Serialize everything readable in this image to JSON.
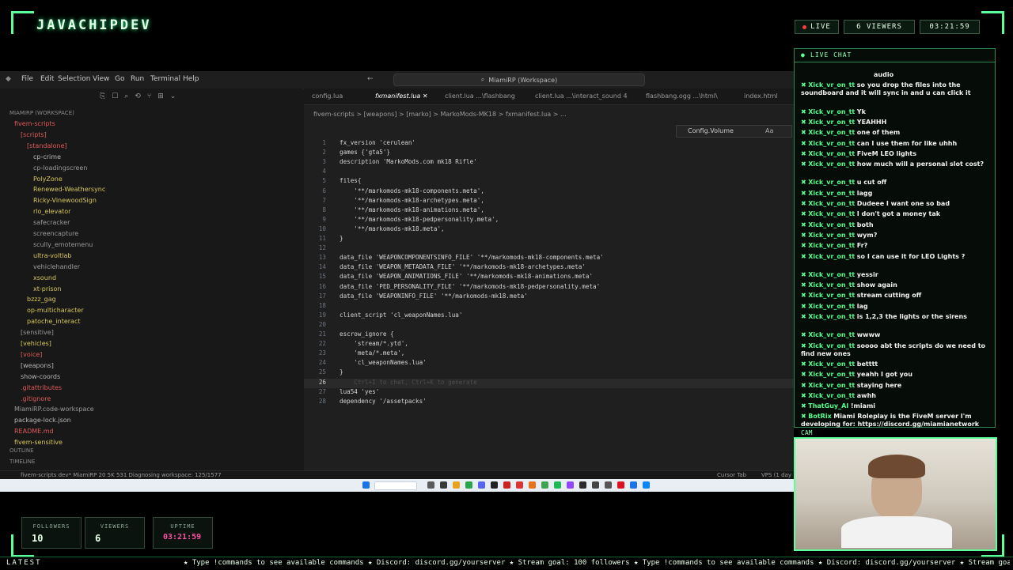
{
  "overlay": {
    "brand": "JAVACHIPDEV",
    "live": "LIVE",
    "viewers": "6  VIEWERS",
    "clock": "03:21:59",
    "chat_title": "LIVE CHAT",
    "cam_label": "CAM",
    "stats": [
      {
        "label": "FOLLOWERS",
        "value": "10"
      },
      {
        "label": "VIEWERS",
        "value": "6"
      },
      {
        "label": "UPTIME",
        "value": "03:21:59"
      }
    ],
    "latest_label": "LATEST",
    "ticker": "★ Type !commands to see available commands ★ Discord: discord.gg/yourserver ★ Stream goal: 100 followers ★ Type !commands to see available commands ★ Discord: discord.gg/yourserver ★ Stream goal: 100 followers"
  },
  "ide": {
    "menu": [
      "File",
      "Edit",
      "Selection",
      "View",
      "Go",
      "Run",
      "Terminal",
      "Help"
    ],
    "search_text": "MiamiRP (Workspace)",
    "workspace_label": "MIAMIRP (WORKSPACE)",
    "tree": [
      {
        "label": "fivem-scripts",
        "indent": 1,
        "color": "#e05a5a"
      },
      {
        "label": "[scripts]",
        "indent": 2,
        "color": "#e05a5a"
      },
      {
        "label": "[standalone]",
        "indent": 3,
        "color": "#e05a5a"
      },
      {
        "label": "cp-crime",
        "indent": 4,
        "color": "#b8b8b8"
      },
      {
        "label": "cp-loadingscreen",
        "indent": 4,
        "color": "#9a9a9a"
      },
      {
        "label": "PolyZone",
        "indent": 4,
        "color": "#d6c65a"
      },
      {
        "label": "Renewed-Weathersync",
        "indent": 4,
        "color": "#d6c65a"
      },
      {
        "label": "Ricky-VinewoodSign",
        "indent": 4,
        "color": "#d6c65a"
      },
      {
        "label": "rlo_elevator",
        "indent": 4,
        "color": "#d6c65a"
      },
      {
        "label": "safecracker",
        "indent": 4,
        "color": "#9a9a9a"
      },
      {
        "label": "screencapture",
        "indent": 4,
        "color": "#9a9a9a"
      },
      {
        "label": "scully_emotemenu",
        "indent": 4,
        "color": "#9a9a9a"
      },
      {
        "label": "ultra-voltlab",
        "indent": 4,
        "color": "#d6c65a"
      },
      {
        "label": "vehiclehandler",
        "indent": 4,
        "color": "#9a9a9a"
      },
      {
        "label": "xsound",
        "indent": 4,
        "color": "#d6c65a"
      },
      {
        "label": "xt-prison",
        "indent": 4,
        "color": "#d6c65a"
      },
      {
        "label": "bzzz_gag",
        "indent": 3,
        "color": "#d6c65a"
      },
      {
        "label": "op-multicharacter",
        "indent": 3,
        "color": "#d6c65a"
      },
      {
        "label": "patoche_interact",
        "indent": 3,
        "color": "#d6c65a"
      },
      {
        "label": "[sensitive]",
        "indent": 2,
        "color": "#9a9a9a"
      },
      {
        "label": "[vehicles]",
        "indent": 2,
        "color": "#d6c65a"
      },
      {
        "label": "[voice]",
        "indent": 2,
        "color": "#e05a5a"
      },
      {
        "label": "[weapons]",
        "indent": 2,
        "color": "#b8b8b8"
      },
      {
        "label": "show-coords",
        "indent": 2,
        "color": "#b8b8b8"
      },
      {
        "label": ".gitattributes",
        "indent": 2,
        "color": "#e05a5a"
      },
      {
        "label": ".gitignore",
        "indent": 2,
        "color": "#e05a5a"
      },
      {
        "label": "MiamiRP.code-workspace",
        "indent": 1,
        "color": "#9a9a9a"
      },
      {
        "label": "package-lock.json",
        "indent": 1,
        "color": "#b8b8b8"
      },
      {
        "label": "README.md",
        "indent": 1,
        "color": "#e05a5a"
      },
      {
        "label": "fivem-sensitive",
        "indent": 1,
        "color": "#d6c65a"
      }
    ],
    "outline_label": "OUTLINE",
    "timeline_label": "TIMELINE",
    "tabs": [
      {
        "label": "config.lua",
        "active": false
      },
      {
        "label": "fxmanifest.lua",
        "active": true
      },
      {
        "label": "client.lua  ...\\flashbang",
        "active": false
      },
      {
        "label": "client.lua  ...\\interact_sound 4",
        "active": false
      },
      {
        "label": "flashbang.ogg  ...\\html\\",
        "active": false
      },
      {
        "label": "index.html",
        "active": false
      }
    ],
    "breadcrumb": "fivem-scripts > [weapons] > [marko] > MarkoMods-MK18 > fxmanifest.lua > ...",
    "find_text": "Config.Volume",
    "code": [
      {
        "n": "1",
        "t": "fx_version 'cerulean'"
      },
      {
        "n": "2",
        "t": "games {'gta5'}"
      },
      {
        "n": "3",
        "t": "description 'MarkoMods.com mk18 Rifle'"
      },
      {
        "n": "4",
        "t": ""
      },
      {
        "n": "5",
        "t": "files{"
      },
      {
        "n": "6",
        "t": "    '**/markomods-mk18-components.meta',"
      },
      {
        "n": "7",
        "t": "    '**/markomods-mk18-archetypes.meta',"
      },
      {
        "n": "8",
        "t": "    '**/markomods-mk18-animations.meta',"
      },
      {
        "n": "9",
        "t": "    '**/markomods-mk18-pedpersonality.meta',"
      },
      {
        "n": "10",
        "t": "    '**/markomods-mk18.meta',"
      },
      {
        "n": "11",
        "t": "}"
      },
      {
        "n": "12",
        "t": ""
      },
      {
        "n": "13",
        "t": "data_file 'WEAPONCOMPONENTSINFO_FILE' '**/markomods-mk18-components.meta'"
      },
      {
        "n": "14",
        "t": "data_file 'WEAPON_METADATA_FILE' '**/markomods-mk18-archetypes.meta'"
      },
      {
        "n": "15",
        "t": "data_file 'WEAPON_ANIMATIONS_FILE' '**/markomods-mk18-animations.meta'"
      },
      {
        "n": "16",
        "t": "data_file 'PED_PERSONALITY_FILE' '**/markomods-mk18-pedpersonality.meta'"
      },
      {
        "n": "17",
        "t": "data_file 'WEAPONINFO_FILE' '**/markomods-mk18.meta'"
      },
      {
        "n": "18",
        "t": ""
      },
      {
        "n": "19",
        "t": "client_script 'cl_weaponNames.lua'"
      },
      {
        "n": "20",
        "t": ""
      },
      {
        "n": "21",
        "t": "escrow_ignore {"
      },
      {
        "n": "22",
        "t": "    'stream/*.ytd',"
      },
      {
        "n": "23",
        "t": "    'meta/*.meta',"
      },
      {
        "n": "24",
        "t": "    'cl_weaponNames.lua'"
      },
      {
        "n": "25",
        "t": "}"
      },
      {
        "n": "26",
        "t": "    Ctrl+I to chat, Ctrl+K to generate"
      },
      {
        "n": "27",
        "t": "lua54 'yes'"
      },
      {
        "n": "28",
        "t": "dependency '/assetpacks'"
      }
    ],
    "status": {
      "left": "fivem-scripts   dev*   MiamiRP   20  5K  531   Diagnosing workspace: 125/1577",
      "cursor": "Cursor Tab",
      "vps": "VPS (1 day"
    }
  },
  "chat": {
    "messages": [
      {
        "user": "",
        "text": "audio"
      },
      {
        "user": "Xick_vr_on_tt",
        "text": "so you drop the files into the soundboard and it will sync in and u can click it"
      },
      {
        "user": "Xick_vr_on_tt",
        "text": "Yk"
      },
      {
        "user": "Xick_vr_on_tt",
        "text": "YEAHHH"
      },
      {
        "user": "Xick_vr_on_tt",
        "text": "one of them"
      },
      {
        "user": "Xick_vr_on_tt",
        "text": "can I use them for like uhhh"
      },
      {
        "user": "Xick_vr_on_tt",
        "text": "FiveM LEO lights"
      },
      {
        "user": "Xick_vr_on_tt",
        "text": "how much will a personal slot cost?"
      },
      {
        "user": "Xick_vr_on_tt",
        "text": "u cut off"
      },
      {
        "user": "Xick_vr_on_tt",
        "text": "lagg"
      },
      {
        "user": "Xick_vr_on_tt",
        "text": "Dudeee I want one so bad"
      },
      {
        "user": "Xick_vr_on_tt",
        "text": "I don't got a money tak"
      },
      {
        "user": "Xick_vr_on_tt",
        "text": "both"
      },
      {
        "user": "Xick_vr_on_tt",
        "text": "wym?"
      },
      {
        "user": "Xick_vr_on_tt",
        "text": "Fr?"
      },
      {
        "user": "Xick_vr_on_tt",
        "text": "so I can use it for LEO Lights ?"
      },
      {
        "user": "Xick_vr_on_tt",
        "text": "yessir"
      },
      {
        "user": "Xick_vr_on_tt",
        "text": "show again"
      },
      {
        "user": "Xick_vr_on_tt",
        "text": "stream cutting off"
      },
      {
        "user": "Xick_vr_on_tt",
        "text": "lag"
      },
      {
        "user": "Xick_vr_on_tt",
        "text": "is 1,2,3 the lights or the sirens"
      },
      {
        "user": "Xick_vr_on_tt",
        "text": "wwww"
      },
      {
        "user": "Xick_vr_on_tt",
        "text": "soooo abt the scripts do we need to find new ones"
      },
      {
        "user": "Xick_vr_on_tt",
        "text": "betttt"
      },
      {
        "user": "Xick_vr_on_tt",
        "text": "yeahh I got you"
      },
      {
        "user": "Xick_vr_on_tt",
        "text": "staying here"
      },
      {
        "user": "Xick_vr_on_tt",
        "text": "awhh"
      },
      {
        "user": "ThatGuy_AI",
        "text": "!miami"
      },
      {
        "user": "BotRix",
        "text": "Miami Roleplay is the FiveM server I'm developing for: https://discord.gg/miamianetwork"
      }
    ]
  },
  "colors": {
    "accent": "#5dff9a",
    "chat_user": "#54ff8e",
    "live_dot": "#ff3b3b"
  }
}
